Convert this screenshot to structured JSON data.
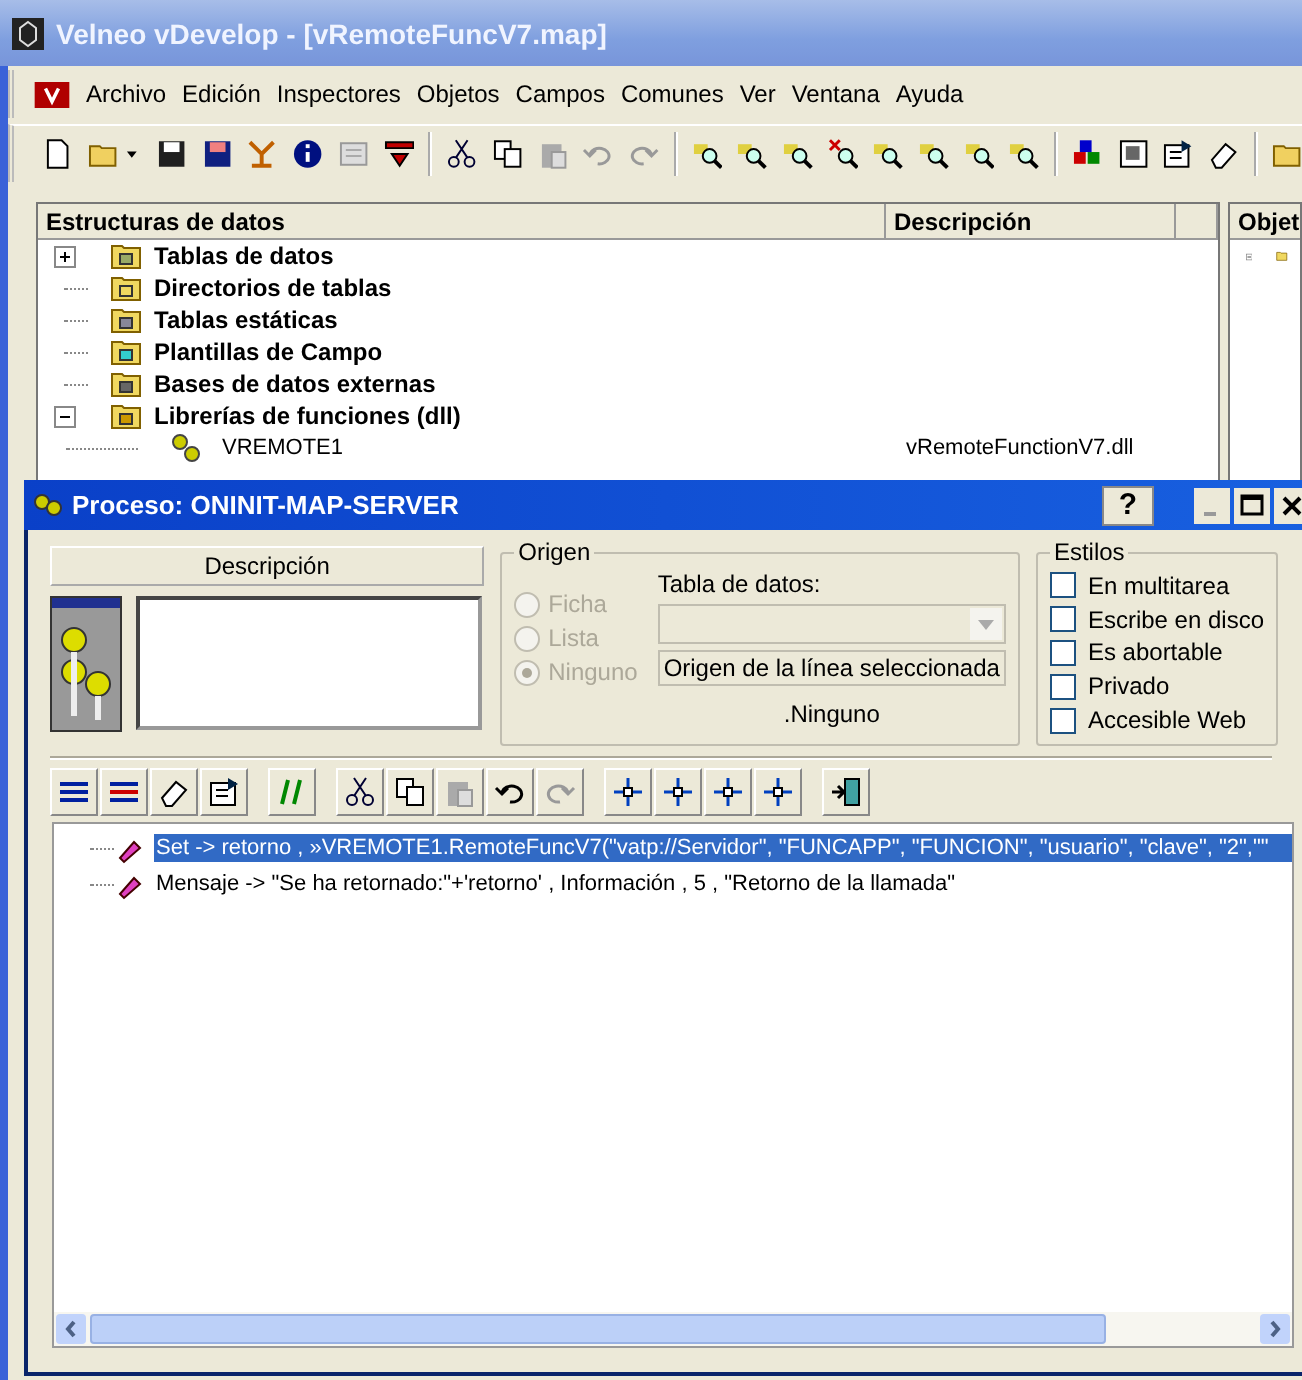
{
  "window": {
    "title": "Velneo vDevelop - [vRemoteFuncV7.map]"
  },
  "menu": [
    "Archivo",
    "Edición",
    "Inspectores",
    "Objetos",
    "Campos",
    "Comunes",
    "Ver",
    "Ventana",
    "Ayuda"
  ],
  "tree": {
    "columns": [
      "Estructuras de datos",
      "Descripción"
    ],
    "items": [
      {
        "label": "Tablas de datos",
        "expanded": false
      },
      {
        "label": "Directorios de tablas"
      },
      {
        "label": "Tablas estáticas"
      },
      {
        "label": "Plantillas de Campo"
      },
      {
        "label": "Bases de datos externas"
      },
      {
        "label": "Librerías de funciones (dll)",
        "expanded": true,
        "children": [
          {
            "label": "VREMOTE1",
            "description": "vRemoteFunctionV7.dll"
          }
        ]
      }
    ]
  },
  "side_panel": {
    "header": "Objet"
  },
  "dialog": {
    "title": "Proceso: ONINIT-MAP-SERVER",
    "help": "?",
    "description_label": "Descripción",
    "origen": {
      "title": "Origen",
      "radios": [
        {
          "label": "Ficha",
          "selected": false,
          "disabled": true
        },
        {
          "label": "Lista",
          "selected": false,
          "disabled": true
        },
        {
          "label": "Ninguno",
          "selected": true,
          "disabled": true
        }
      ],
      "table_label": "Tabla de datos:",
      "table_combo": {
        "disabled": true
      },
      "origin_button": "Origen de la línea seleccionada",
      "origin_value": ".Ninguno"
    },
    "estilos": {
      "title": "Estilos",
      "options": [
        {
          "label": "En multitarea",
          "checked": false
        },
        {
          "label": "Escribe en disco",
          "checked": false
        },
        {
          "label": "Es abortable",
          "checked": false
        },
        {
          "label": "Privado",
          "checked": false
        },
        {
          "label": "Accesible Web",
          "checked": false
        }
      ]
    },
    "lines": [
      {
        "text": "Set -> retorno , »VREMOTE1.RemoteFuncV7(\"vatp://Servidor\", \"FUNCAPP\", \"FUNCION\", \"usuario\", \"clave\", \"2\",\"\"",
        "selected": true
      },
      {
        "text": "Mensaje -> \"Se ha retornado:\"+'retorno' , Información , 5 , \"Retorno de la llamada\"",
        "selected": false
      }
    ]
  }
}
